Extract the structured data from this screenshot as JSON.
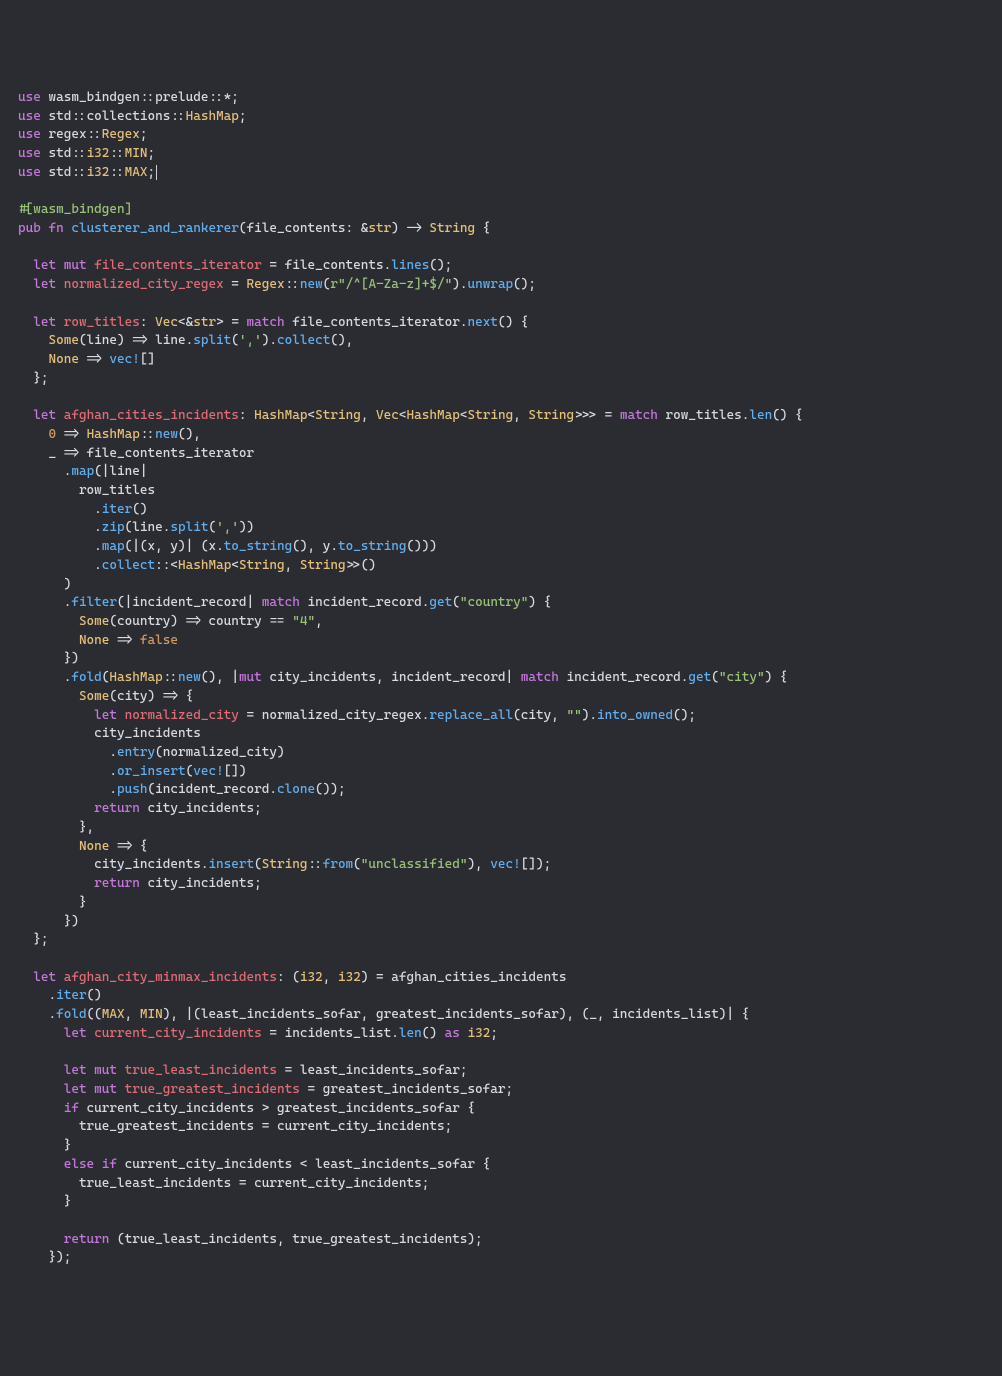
{
  "lines": [
    [
      [
        "kw",
        "use"
      ],
      [
        "id",
        " wasm_bindgen::prelude::*;"
      ]
    ],
    [
      [
        "kw",
        "use"
      ],
      [
        "id",
        " std::collections::"
      ],
      [
        "ty",
        "HashMap"
      ],
      [
        "id",
        ";"
      ]
    ],
    [
      [
        "kw",
        "use"
      ],
      [
        "id",
        " regex::"
      ],
      [
        "ty",
        "Regex"
      ],
      [
        "id",
        ";"
      ]
    ],
    [
      [
        "kw",
        "use"
      ],
      [
        "id",
        " std::"
      ],
      [
        "ty",
        "i32"
      ],
      [
        "id",
        "::"
      ],
      [
        "ty",
        "MIN"
      ],
      [
        "id",
        ";"
      ]
    ],
    [
      [
        "kw",
        "use"
      ],
      [
        "id",
        " std::"
      ],
      [
        "ty",
        "i32"
      ],
      [
        "id",
        "::"
      ],
      [
        "ty",
        "MAX"
      ],
      [
        "id",
        ";"
      ],
      [
        "cursor",
        ""
      ]
    ],
    [],
    [
      [
        "attr",
        "#[wasm_bindgen]"
      ]
    ],
    [
      [
        "kw",
        "pub fn"
      ],
      [
        "id",
        " "
      ],
      [
        "fn",
        "clusterer_and_rankerer"
      ],
      [
        "id",
        "(file_contents: &"
      ],
      [
        "ty",
        "str"
      ],
      [
        "id",
        ") -> "
      ],
      [
        "ty",
        "String"
      ],
      [
        "id",
        " {"
      ]
    ],
    [],
    [
      [
        "id",
        "  "
      ],
      [
        "kw",
        "let mut"
      ],
      [
        "id",
        " "
      ],
      [
        "def",
        "file_contents_iterator"
      ],
      [
        "id",
        " = file_contents."
      ],
      [
        "fn",
        "lines"
      ],
      [
        "id",
        "();"
      ]
    ],
    [
      [
        "id",
        "  "
      ],
      [
        "kw",
        "let"
      ],
      [
        "id",
        " "
      ],
      [
        "def",
        "normalized_city_regex"
      ],
      [
        "id",
        " = "
      ],
      [
        "ty",
        "Regex"
      ],
      [
        "id",
        "::"
      ],
      [
        "fn",
        "new"
      ],
      [
        "id",
        "("
      ],
      [
        "str",
        "r\"/^[A-Za-z]+$/\""
      ],
      [
        "id",
        ")."
      ],
      [
        "fn",
        "unwrap"
      ],
      [
        "id",
        "();"
      ]
    ],
    [],
    [
      [
        "id",
        "  "
      ],
      [
        "kw",
        "let"
      ],
      [
        "id",
        " "
      ],
      [
        "def",
        "row_titles"
      ],
      [
        "id",
        ": "
      ],
      [
        "ty",
        "Vec"
      ],
      [
        "id",
        "<&"
      ],
      [
        "ty",
        "str"
      ],
      [
        "id",
        "> = "
      ],
      [
        "kw",
        "match"
      ],
      [
        "id",
        " file_contents_iterator."
      ],
      [
        "fn",
        "next"
      ],
      [
        "id",
        "() {"
      ]
    ],
    [
      [
        "id",
        "    "
      ],
      [
        "ty",
        "Some"
      ],
      [
        "id",
        "(line) => line."
      ],
      [
        "fn",
        "split"
      ],
      [
        "id",
        "("
      ],
      [
        "str",
        "','"
      ],
      [
        "id",
        ")."
      ],
      [
        "fn",
        "collect"
      ],
      [
        "id",
        "(),"
      ]
    ],
    [
      [
        "id",
        "    "
      ],
      [
        "ty",
        "None"
      ],
      [
        "id",
        " => "
      ],
      [
        "fn",
        "vec!"
      ],
      [
        "id",
        "[]"
      ]
    ],
    [
      [
        "id",
        "  };"
      ]
    ],
    [],
    [
      [
        "id",
        "  "
      ],
      [
        "kw",
        "let"
      ],
      [
        "id",
        " "
      ],
      [
        "def",
        "afghan_cities_incidents"
      ],
      [
        "id",
        ": "
      ],
      [
        "ty",
        "HashMap"
      ],
      [
        "id",
        "<"
      ],
      [
        "ty",
        "String"
      ],
      [
        "id",
        ", "
      ],
      [
        "ty",
        "Vec"
      ],
      [
        "id",
        "<"
      ],
      [
        "ty",
        "HashMap"
      ],
      [
        "id",
        "<"
      ],
      [
        "ty",
        "String"
      ],
      [
        "id",
        ", "
      ],
      [
        "ty",
        "String"
      ],
      [
        "id",
        ">>> = "
      ],
      [
        "kw",
        "match"
      ],
      [
        "id",
        " row_titles."
      ],
      [
        "fn",
        "len"
      ],
      [
        "id",
        "() {"
      ]
    ],
    [
      [
        "id",
        "    "
      ],
      [
        "num",
        "0"
      ],
      [
        "id",
        " => "
      ],
      [
        "ty",
        "HashMap"
      ],
      [
        "id",
        "::"
      ],
      [
        "fn",
        "new"
      ],
      [
        "id",
        "(),"
      ]
    ],
    [
      [
        "id",
        "    _ => file_contents_iterator"
      ]
    ],
    [
      [
        "id",
        "      ."
      ],
      [
        "fn",
        "map"
      ],
      [
        "id",
        "(|line|"
      ]
    ],
    [
      [
        "id",
        "        row_titles"
      ]
    ],
    [
      [
        "id",
        "          ."
      ],
      [
        "fn",
        "iter"
      ],
      [
        "id",
        "()"
      ]
    ],
    [
      [
        "id",
        "          ."
      ],
      [
        "fn",
        "zip"
      ],
      [
        "id",
        "(line."
      ],
      [
        "fn",
        "split"
      ],
      [
        "id",
        "("
      ],
      [
        "str",
        "','"
      ],
      [
        "id",
        "))"
      ]
    ],
    [
      [
        "id",
        "          ."
      ],
      [
        "fn",
        "map"
      ],
      [
        "id",
        "(|(x, y)| (x."
      ],
      [
        "fn",
        "to_string"
      ],
      [
        "id",
        "(), y."
      ],
      [
        "fn",
        "to_string"
      ],
      [
        "id",
        "()))"
      ]
    ],
    [
      [
        "id",
        "          ."
      ],
      [
        "fn",
        "collect"
      ],
      [
        "id",
        "::<"
      ],
      [
        "ty",
        "HashMap"
      ],
      [
        "id",
        "<"
      ],
      [
        "ty",
        "String"
      ],
      [
        "id",
        ", "
      ],
      [
        "ty",
        "String"
      ],
      [
        "id",
        ">>()"
      ]
    ],
    [
      [
        "id",
        "      )"
      ]
    ],
    [
      [
        "id",
        "      ."
      ],
      [
        "fn",
        "filter"
      ],
      [
        "id",
        "(|incident_record| "
      ],
      [
        "kw",
        "match"
      ],
      [
        "id",
        " incident_record."
      ],
      [
        "fn",
        "get"
      ],
      [
        "id",
        "("
      ],
      [
        "str",
        "\"country\""
      ],
      [
        "id",
        ") {"
      ]
    ],
    [
      [
        "id",
        "        "
      ],
      [
        "ty",
        "Some"
      ],
      [
        "id",
        "(country) => country == "
      ],
      [
        "str",
        "\"4\""
      ],
      [
        "id",
        ","
      ]
    ],
    [
      [
        "id",
        "        "
      ],
      [
        "ty",
        "None"
      ],
      [
        "id",
        " => "
      ],
      [
        "bool",
        "false"
      ]
    ],
    [
      [
        "id",
        "      })"
      ]
    ],
    [
      [
        "id",
        "      ."
      ],
      [
        "fn",
        "fold"
      ],
      [
        "id",
        "("
      ],
      [
        "ty",
        "HashMap"
      ],
      [
        "id",
        "::"
      ],
      [
        "fn",
        "new"
      ],
      [
        "id",
        "(), |"
      ],
      [
        "kw",
        "mut"
      ],
      [
        "id",
        " city_incidents, incident_record| "
      ],
      [
        "kw",
        "match"
      ],
      [
        "id",
        " incident_record."
      ],
      [
        "fn",
        "get"
      ],
      [
        "id",
        "("
      ],
      [
        "str",
        "\"city\""
      ],
      [
        "id",
        ") {"
      ]
    ],
    [
      [
        "id",
        "        "
      ],
      [
        "ty",
        "Some"
      ],
      [
        "id",
        "(city) => {"
      ]
    ],
    [
      [
        "id",
        "          "
      ],
      [
        "kw",
        "let"
      ],
      [
        "id",
        " "
      ],
      [
        "def",
        "normalized_city"
      ],
      [
        "id",
        " = normalized_city_regex."
      ],
      [
        "fn",
        "replace_all"
      ],
      [
        "id",
        "(city, "
      ],
      [
        "str",
        "\"\""
      ],
      [
        "id",
        ")."
      ],
      [
        "fn",
        "into_owned"
      ],
      [
        "id",
        "();"
      ]
    ],
    [
      [
        "id",
        "          city_incidents"
      ]
    ],
    [
      [
        "id",
        "            ."
      ],
      [
        "fn",
        "entry"
      ],
      [
        "id",
        "(normalized_city)"
      ]
    ],
    [
      [
        "id",
        "            ."
      ],
      [
        "fn",
        "or_insert"
      ],
      [
        "id",
        "("
      ],
      [
        "fn",
        "vec!"
      ],
      [
        "id",
        "[])"
      ]
    ],
    [
      [
        "id",
        "            ."
      ],
      [
        "fn",
        "push"
      ],
      [
        "id",
        "(incident_record."
      ],
      [
        "fn",
        "clone"
      ],
      [
        "id",
        "());"
      ]
    ],
    [
      [
        "id",
        "          "
      ],
      [
        "kw",
        "return"
      ],
      [
        "id",
        " city_incidents;"
      ]
    ],
    [
      [
        "id",
        "        },"
      ]
    ],
    [
      [
        "id",
        "        "
      ],
      [
        "ty",
        "None"
      ],
      [
        "id",
        " => {"
      ]
    ],
    [
      [
        "id",
        "          city_incidents."
      ],
      [
        "fn",
        "insert"
      ],
      [
        "id",
        "("
      ],
      [
        "ty",
        "String"
      ],
      [
        "id",
        "::"
      ],
      [
        "fn",
        "from"
      ],
      [
        "id",
        "("
      ],
      [
        "str",
        "\"unclassified\""
      ],
      [
        "id",
        "), "
      ],
      [
        "fn",
        "vec!"
      ],
      [
        "id",
        "[]);"
      ]
    ],
    [
      [
        "id",
        "          "
      ],
      [
        "kw",
        "return"
      ],
      [
        "id",
        " city_incidents;"
      ]
    ],
    [
      [
        "id",
        "        }"
      ]
    ],
    [
      [
        "id",
        "      })"
      ]
    ],
    [
      [
        "id",
        "  };"
      ]
    ],
    [],
    [
      [
        "id",
        "  "
      ],
      [
        "kw",
        "let"
      ],
      [
        "id",
        " "
      ],
      [
        "def",
        "afghan_city_minmax_incidents"
      ],
      [
        "id",
        ": ("
      ],
      [
        "ty",
        "i32"
      ],
      [
        "id",
        ", "
      ],
      [
        "ty",
        "i32"
      ],
      [
        "id",
        ") = afghan_cities_incidents"
      ]
    ],
    [
      [
        "id",
        "    ."
      ],
      [
        "fn",
        "iter"
      ],
      [
        "id",
        "()"
      ]
    ],
    [
      [
        "id",
        "    ."
      ],
      [
        "fn",
        "fold"
      ],
      [
        "id",
        "(("
      ],
      [
        "ty",
        "MAX"
      ],
      [
        "id",
        ", "
      ],
      [
        "ty",
        "MIN"
      ],
      [
        "id",
        "), |(least_incidents_sofar, greatest_incidents_sofar), (_, incidents_list)| {"
      ]
    ],
    [
      [
        "id",
        "      "
      ],
      [
        "kw",
        "let"
      ],
      [
        "id",
        " "
      ],
      [
        "def",
        "current_city_incidents"
      ],
      [
        "id",
        " = incidents_list."
      ],
      [
        "fn",
        "len"
      ],
      [
        "id",
        "() "
      ],
      [
        "kw",
        "as"
      ],
      [
        "id",
        " "
      ],
      [
        "ty",
        "i32"
      ],
      [
        "id",
        ";"
      ]
    ],
    [],
    [
      [
        "id",
        "      "
      ],
      [
        "kw",
        "let mut"
      ],
      [
        "id",
        " "
      ],
      [
        "def",
        "true_least_incidents"
      ],
      [
        "id",
        " = least_incidents_sofar;"
      ]
    ],
    [
      [
        "id",
        "      "
      ],
      [
        "kw",
        "let mut"
      ],
      [
        "id",
        " "
      ],
      [
        "def",
        "true_greatest_incidents"
      ],
      [
        "id",
        " = greatest_incidents_sofar;"
      ]
    ],
    [
      [
        "id",
        "      "
      ],
      [
        "kw",
        "if"
      ],
      [
        "id",
        " current_city_incidents > greatest_incidents_sofar {"
      ]
    ],
    [
      [
        "id",
        "        true_greatest_incidents = current_city_incidents;"
      ]
    ],
    [
      [
        "id",
        "      }"
      ]
    ],
    [
      [
        "id",
        "      "
      ],
      [
        "kw",
        "else if"
      ],
      [
        "id",
        " current_city_incidents < least_incidents_sofar {"
      ]
    ],
    [
      [
        "id",
        "        true_least_incidents = current_city_incidents;"
      ]
    ],
    [
      [
        "id",
        "      }"
      ]
    ],
    [],
    [
      [
        "id",
        "      "
      ],
      [
        "kw",
        "return"
      ],
      [
        "id",
        " (true_least_incidents, true_greatest_incidents);"
      ]
    ],
    [
      [
        "id",
        "    });"
      ]
    ]
  ]
}
